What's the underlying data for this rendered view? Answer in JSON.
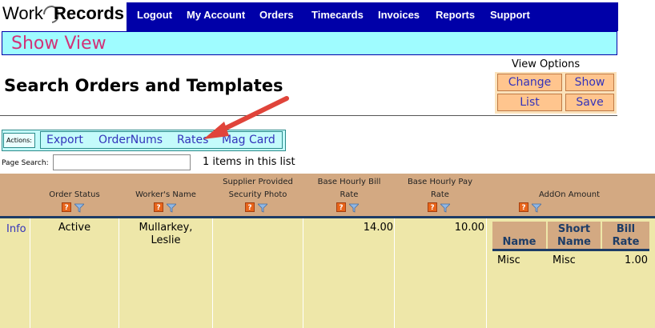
{
  "brand": {
    "logo_part1": "Work",
    "logo_part2": "Records"
  },
  "nav": {
    "items": [
      "Logout",
      "My Account",
      "Orders",
      "Timecards",
      "Invoices",
      "Reports",
      "Support"
    ]
  },
  "view_bar": {
    "title": "Show View"
  },
  "page": {
    "title": "Search Orders and Templates"
  },
  "view_options": {
    "label": "View Options",
    "buttons": {
      "change": "Change",
      "show": "Show",
      "list": "List",
      "save": "Save"
    }
  },
  "actions": {
    "label": "Actions:",
    "links": [
      "Export",
      "OrderNums",
      "Rates",
      "Mag Card"
    ]
  },
  "search": {
    "label": "Page Search:",
    "value": "",
    "items_count_text": "1 items in this list"
  },
  "table": {
    "headers": {
      "order_status": "Order Status",
      "workers_name": "Worker's Name",
      "supplier_photo_1": "Supplier Provided",
      "supplier_photo_2": "Security Photo",
      "bill_rate_1": "Base Hourly Bill",
      "bill_rate_2": "Rate",
      "pay_rate_1": "Base Hourly Pay",
      "pay_rate_2": "Rate",
      "addon_amount": "AddOn Amount"
    },
    "row": {
      "info_link": "Info",
      "order_status": "Active",
      "workers_name_line1": "Mullarkey,",
      "workers_name_line2": "Leslie",
      "bill_rate": "14.00",
      "pay_rate": "10.00"
    },
    "addon": {
      "headers": {
        "name": "Name",
        "short_name_1": "Short",
        "short_name_2": "Name",
        "bill_rate_1": "Bill",
        "bill_rate_2": "Rate"
      },
      "rows": [
        {
          "name": "Misc",
          "short_name": "Misc",
          "bill_rate": "1.00"
        }
      ]
    }
  },
  "colors": {
    "nav_bg": "#0000a8",
    "view_bar_bg": "#9ffcff",
    "view_title": "#d23278",
    "header_bg": "#d3a982",
    "body_bg": "#eee7a9",
    "link": "#3333bb",
    "annotation_arrow": "#e0443a"
  },
  "icons": [
    "help-icon",
    "filter-icon",
    "arrow-annotation"
  ]
}
